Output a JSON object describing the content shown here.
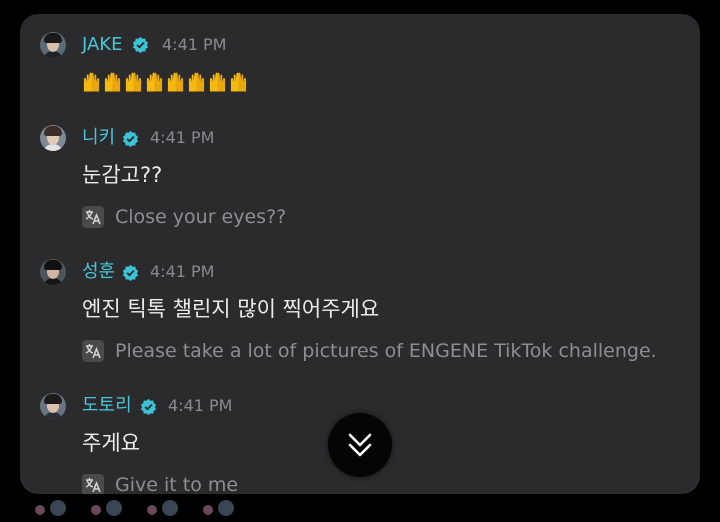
{
  "colors": {
    "panel_bg": "#2b2b2d",
    "name_color": "#46c8d8",
    "verified_color": "#3cc3d6",
    "time_color": "#8a8a8e",
    "text_color": "#ececec",
    "translation_color": "#8e8e92",
    "emoji_color": "#f5b912"
  },
  "messages": [
    {
      "author": "JAKE",
      "time": "4:41 PM",
      "avatar_icon": "avatar-jake-icon",
      "text": "",
      "emoji_count": 8,
      "emoji": "raising-hands-emoji",
      "translation": ""
    },
    {
      "author": "니키",
      "time": "4:41 PM",
      "avatar_icon": "avatar-niki-icon",
      "text": "눈감고??",
      "translation": "Close your eyes??"
    },
    {
      "author": "성훈",
      "time": "4:41 PM",
      "avatar_icon": "avatar-sunghoon-icon",
      "text": "엔진 틱톡 챌린지 많이 찍어주게요",
      "translation": "Please take a lot of pictures of ENGENE TikTok challenge."
    },
    {
      "author": "도토리",
      "time": "4:41 PM",
      "avatar_icon": "avatar-dotori-icon",
      "text": "주게요",
      "translation": "Give it to me"
    }
  ],
  "scroll_button": {
    "icon": "double-chevron-down-icon"
  }
}
